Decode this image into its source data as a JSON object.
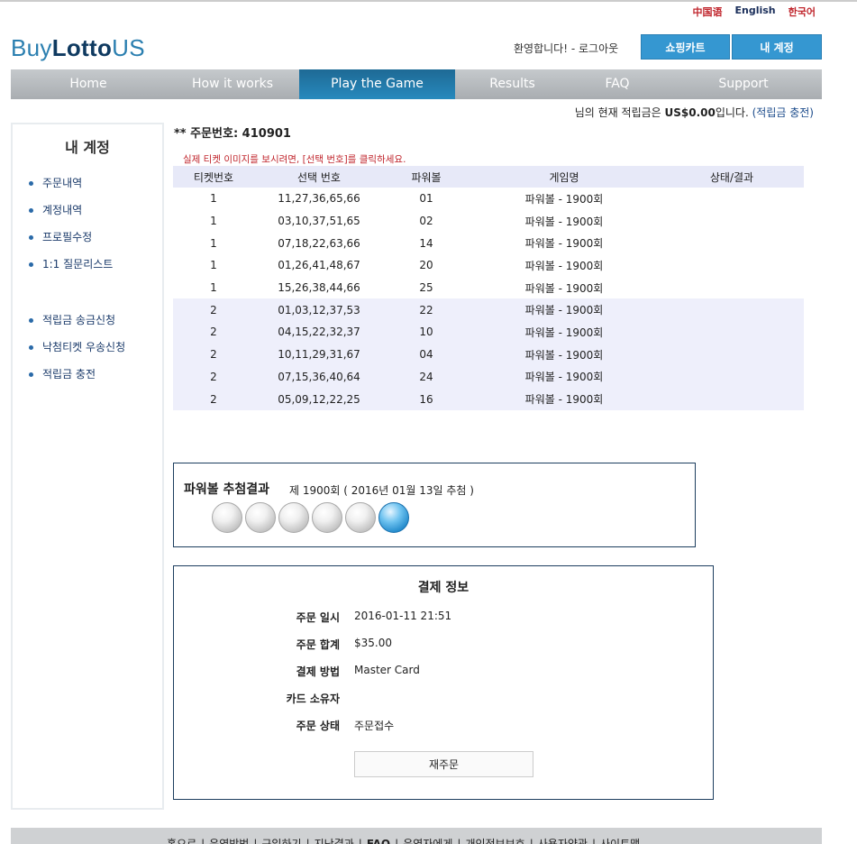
{
  "languages": [
    "中国语",
    "English",
    "한국어"
  ],
  "logo": {
    "part1": "Buy",
    "part2": "Lotto",
    "part3": "US"
  },
  "header": {
    "welcome": "환영합니다! - ",
    "logout": "로그아웃",
    "cart": "쇼핑카트",
    "account": "내 계정"
  },
  "nav": [
    "Home",
    "How it works",
    "Play the Game",
    "Results",
    "FAQ",
    "Support"
  ],
  "balance": {
    "prefix": "님의 현재 적립금은 ",
    "amount": "US$0.00",
    "suffix": "입니다.",
    "charge": "(적립금 충전)"
  },
  "sidebar": {
    "title": "내 계정",
    "group1": [
      "주문내역",
      "계정내역",
      "프로필수정",
      "1:1 질문리스트"
    ],
    "group2": [
      "적립금 송금신청",
      "낙첨티켓 우송신청",
      "적립금 충전"
    ]
  },
  "order": {
    "label": "** 주문번호: 410901",
    "notice": "실제 티켓 이미지를 보시려면, [선택 번호]를 클릭하세요."
  },
  "table": {
    "headers": [
      "티켓번호",
      "선택 번호",
      "파워볼",
      "게임명",
      "상태/결과"
    ],
    "rows": [
      [
        "1",
        "11,27,36,65,66",
        "01",
        "파워볼 - 1900회",
        ""
      ],
      [
        "1",
        "03,10,37,51,65",
        "02",
        "파워볼 - 1900회",
        ""
      ],
      [
        "1",
        "07,18,22,63,66",
        "14",
        "파워볼 - 1900회",
        ""
      ],
      [
        "1",
        "01,26,41,48,67",
        "20",
        "파워볼 - 1900회",
        ""
      ],
      [
        "1",
        "15,26,38,44,66",
        "25",
        "파워볼 - 1900회",
        ""
      ],
      [
        "2",
        "01,03,12,37,53",
        "22",
        "파워볼 - 1900회",
        ""
      ],
      [
        "2",
        "04,15,22,32,37",
        "10",
        "파워볼 - 1900회",
        ""
      ],
      [
        "2",
        "10,11,29,31,67",
        "04",
        "파워볼 - 1900회",
        ""
      ],
      [
        "2",
        "07,15,36,40,64",
        "24",
        "파워볼 - 1900회",
        ""
      ],
      [
        "2",
        "05,09,12,22,25",
        "16",
        "파워볼 - 1900회",
        ""
      ]
    ]
  },
  "draw": {
    "title": "파워볼 추첨결과",
    "subtitle": "제 1900회 ( 2016년 01월 13일 추첨 )",
    "balls": [
      "white",
      "white",
      "white",
      "white",
      "white",
      "blue"
    ]
  },
  "payment": {
    "title": "결제 정보",
    "rows": [
      {
        "label": "주문 일시",
        "value": "2016-01-11 21:51"
      },
      {
        "label": "주문 합계",
        "value": "$35.00"
      },
      {
        "label": "결제 방법",
        "value": "Master Card"
      },
      {
        "label": "카드 소유자",
        "value": ""
      },
      {
        "label": "주문 상태",
        "value": "주문접수"
      }
    ],
    "reorder": "재주문"
  },
  "footer": [
    "홈으로",
    "운영방법",
    "구입하기",
    "지난결과",
    "FAQ",
    "운영자에게",
    "개인정보보호",
    "사용자약관",
    "사이트맵"
  ],
  "colors": {
    "accent": "#3597d1",
    "nav_active": "#1e6a95",
    "notice": "#c0262d",
    "link": "#1a3a6a"
  }
}
